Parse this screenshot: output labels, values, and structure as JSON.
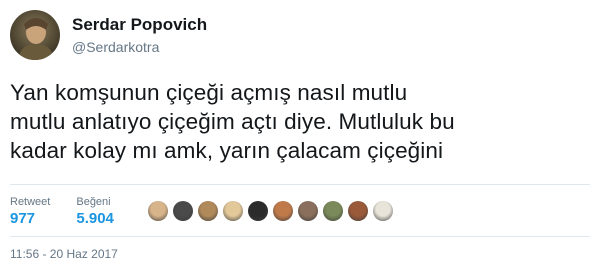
{
  "author": {
    "name": "Serdar Popovich",
    "handle": "@Serdarkotra"
  },
  "tweet": {
    "lines": [
      "Yan komşunun çiçeği açmış nasıl mutlu",
      "mutlu anlatıyo çiçeğim açtı diye. Mutluluk bu",
      "kadar kolay mı amk, yarın çalacam çiçeğini"
    ]
  },
  "stats": {
    "retweet_label": "Retweet",
    "retweet_count": "977",
    "like_label": "Beğeni",
    "like_count": "5.904"
  },
  "likers": [
    {
      "name": "liker-avatar-1",
      "color": "#d8b48a"
    },
    {
      "name": "liker-avatar-2",
      "color": "#4a4a4a"
    },
    {
      "name": "liker-avatar-3",
      "color": "#b08a5a"
    },
    {
      "name": "liker-avatar-4",
      "color": "#e3c89a"
    },
    {
      "name": "liker-avatar-5",
      "color": "#2b2b2b"
    },
    {
      "name": "liker-avatar-6",
      "color": "#c07a4a"
    },
    {
      "name": "liker-avatar-7",
      "color": "#8a6f5c"
    },
    {
      "name": "liker-avatar-8",
      "color": "#7a8a5a"
    },
    {
      "name": "liker-avatar-9",
      "color": "#9a5a3a"
    },
    {
      "name": "liker-avatar-10",
      "color": "#e8e4da"
    }
  ],
  "timestamp": "11:56 - 20 Haz 2017",
  "colors": {
    "link_blue": "#1b95e0",
    "text_dark": "#14171a",
    "text_gray": "#657786"
  }
}
